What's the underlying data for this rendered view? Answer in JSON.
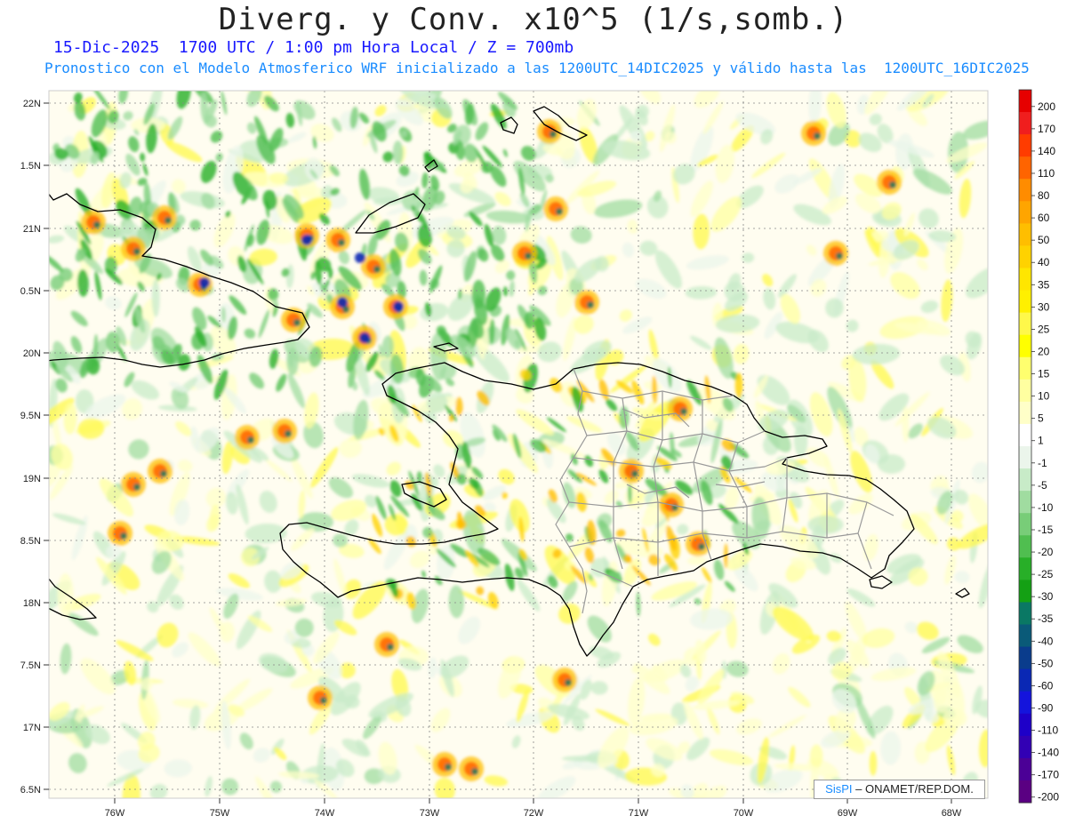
{
  "title": "Diverg. y Conv. x10^5 (1/s,somb.)",
  "subtitle_line1": "15-Dic-2025  1700 UTC / 1:00 pm Hora Local / Z = 700mb",
  "subtitle_line2": "Pronostico con el Modelo Atmosferico WRF inicializado a las 1200UTC_14DIC2025 y válido hasta las  1200UTC_16DIC2025",
  "credit": {
    "brand": "SisPI",
    "text": "– ONAMET/REP.DOM."
  },
  "axes": {
    "x_ticks": [
      "76W",
      "75W",
      "74W",
      "73W",
      "72W",
      "71W",
      "70W",
      "69W",
      "68W"
    ],
    "y_ticks": [
      "22N",
      "1.5N",
      "21N",
      "0.5N",
      "20N",
      "9.5N",
      "19N",
      "8.5N",
      "18N",
      "7.5N",
      "17N",
      "6.5N"
    ]
  },
  "colorbar": {
    "labels": [
      "200",
      "170",
      "140",
      "110",
      "80",
      "60",
      "50",
      "40",
      "35",
      "30",
      "25",
      "20",
      "15",
      "10",
      "5",
      "1",
      "-1",
      "-5",
      "-10",
      "-15",
      "-20",
      "-25",
      "-30",
      "-35",
      "-40",
      "-50",
      "-60",
      "-90",
      "-110",
      "-140",
      "-170",
      "-200"
    ],
    "colors": [
      "#e60000",
      "#f01e1e",
      "#ff3c00",
      "#ff6400",
      "#ff8c00",
      "#ffa500",
      "#ffbe00",
      "#ffd200",
      "#ffe600",
      "#fff000",
      "#fff84a",
      "#ffff00",
      "#ffff6e",
      "#ffffa0",
      "#ffffc8",
      "#ffffff",
      "#ebf5eb",
      "#c8ebc8",
      "#a0dca0",
      "#78cd78",
      "#50be50",
      "#28af28",
      "#14a014",
      "#0a7864",
      "#0a5a78",
      "#0a3c8c",
      "#0a28b4",
      "#1414dc",
      "#1e00c8",
      "#3200b4",
      "#4b0096",
      "#5a0082"
    ]
  },
  "map_layers": [
    "divergence-field",
    "coastlines",
    "dominican-provinces"
  ]
}
